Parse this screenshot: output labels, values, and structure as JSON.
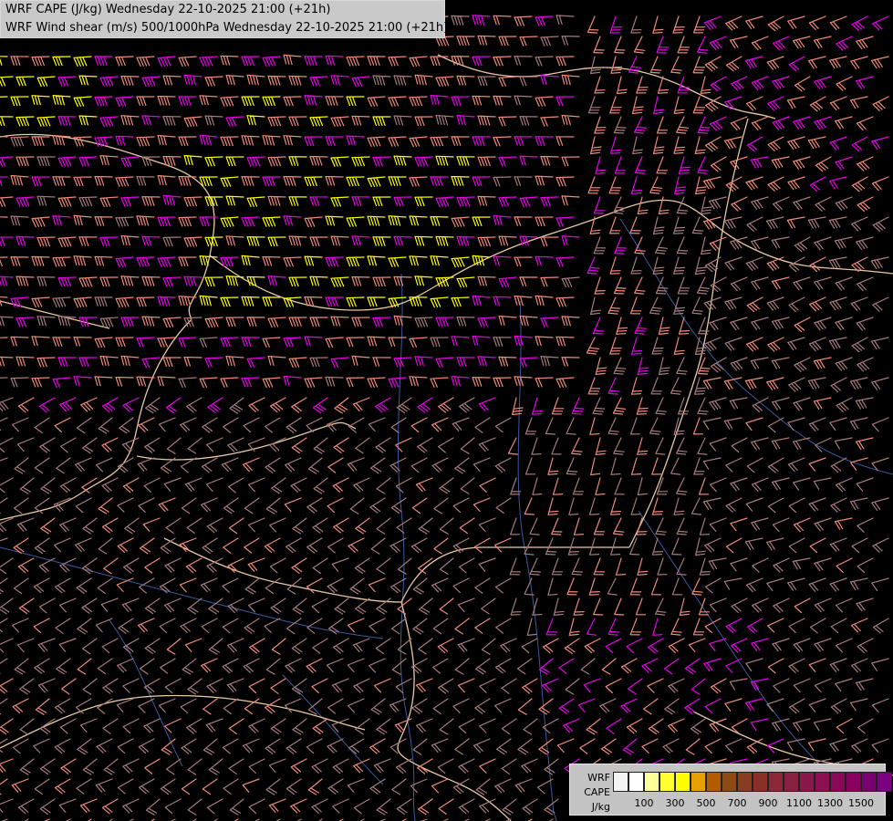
{
  "header": {
    "line1": "WRF CAPE (J/kg) Wednesday 22-10-2025 21:00 (+21h)",
    "line2": "WRF Wind shear (m/s) 500/1000hPa Wednesday 22-10-2025 21:00 (+21h)"
  },
  "legend": {
    "label1": "WRF",
    "label2": "CAPE",
    "label3": "J/kg",
    "colors": [
      "#f4f4f4",
      "#ffffff",
      "#ffff99",
      "#ffff33",
      "#ffff00",
      "#e6a000",
      "#b45a00",
      "#8c4a14",
      "#8a3c1e",
      "#8a3028",
      "#8a2838",
      "#8a2040",
      "#8a1848",
      "#8a1050",
      "#8a0858",
      "#8a0060",
      "#7a0070",
      "#7a0080"
    ],
    "ticks": [
      "100",
      "300",
      "500",
      "700",
      "900",
      "1100",
      "1300",
      "1500"
    ]
  },
  "map": {
    "colors": {
      "barb_default": "#a87a7a",
      "barb_salmon": "#f08a78",
      "barb_magenta": "#e600e6",
      "barb_yellow": "#ffff00",
      "border": "#e8c8a0",
      "river": "#3a5aa0"
    }
  }
}
